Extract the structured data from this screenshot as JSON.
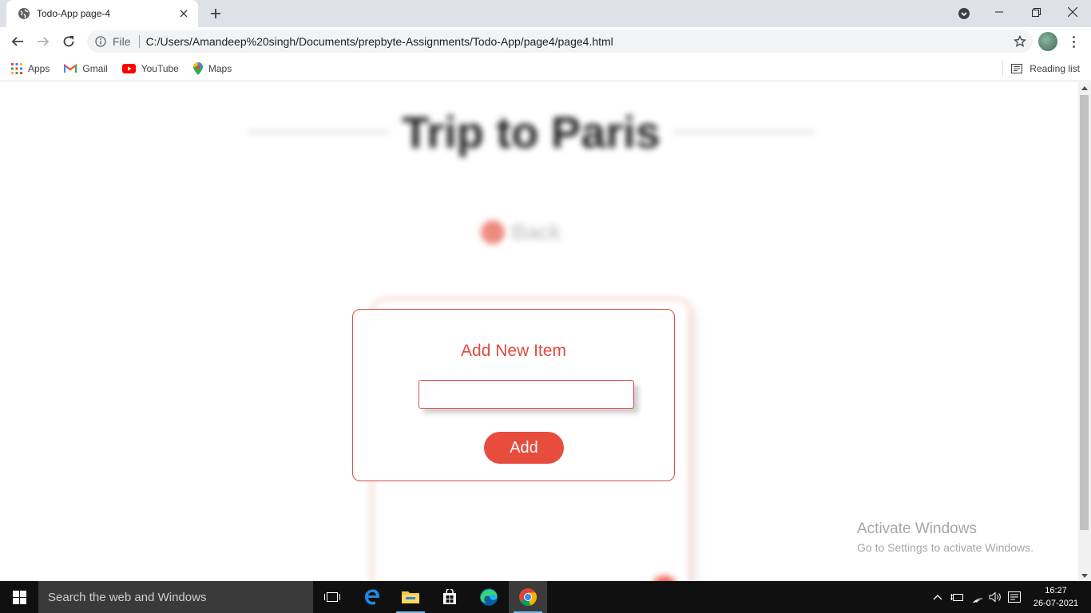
{
  "browser": {
    "tab_title": "Todo-App page-4",
    "site_info_label": "File",
    "url": "C:/Users/Amandeep%20singh/Documents/prepbyte-Assignments/Todo-App/page4/page4.html",
    "bookmarks": [
      "Apps",
      "Gmail",
      "YouTube",
      "Maps"
    ],
    "reading_list": "Reading list"
  },
  "page": {
    "background_title": "Trip to Paris",
    "background_back": "Back",
    "modal": {
      "title": "Add New Item",
      "input_value": "",
      "add_label": "Add"
    },
    "accent_color": "#e84c3d"
  },
  "watermark": {
    "title": "Activate Windows",
    "subtitle": "Go to Settings to activate Windows."
  },
  "taskbar": {
    "search_placeholder": "Search the web and Windows",
    "time": "16:27",
    "date": "26-07-2021",
    "icons": [
      "windows-start-icon",
      "task-view-icon",
      "edge-legacy-icon",
      "file-explorer-icon",
      "store-icon",
      "edge-icon",
      "chrome-icon"
    ]
  }
}
